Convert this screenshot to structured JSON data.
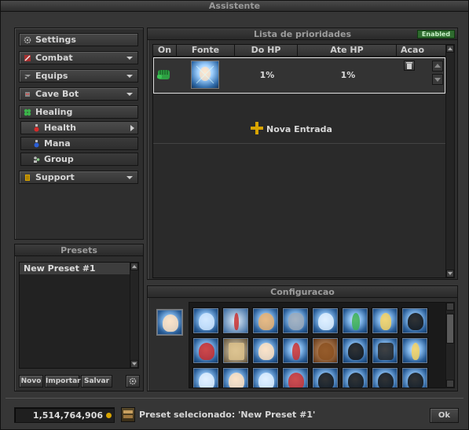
{
  "window": {
    "title": "Assistente"
  },
  "menu": {
    "settings": "Settings",
    "combat": "Combat",
    "equips": "Equips",
    "cavebot": "Cave Bot",
    "healing": "Healing",
    "health": "Health",
    "mana": "Mana",
    "group": "Group",
    "support": "Support"
  },
  "presets": {
    "title": "Presets",
    "items": [
      "New Preset #1"
    ],
    "novo": "Novo",
    "importar": "Importar",
    "salvar": "Salvar"
  },
  "priority": {
    "title": "Lista de prioridades",
    "badge": "Enabled",
    "columns": {
      "on": "On",
      "fonte": "Fonte",
      "do_hp": "Do HP",
      "ate_hp": "Ate HP",
      "acao": "Acao"
    },
    "row": {
      "do_hp": "1%",
      "ate_hp": "1%"
    },
    "add_label": "Nova Entrada"
  },
  "config": {
    "title": "Configuracao"
  },
  "footer": {
    "gold": "1,514,764,906",
    "status": "Preset selecionado: 'New Preset #1'",
    "ok": "Ok"
  },
  "colors": {
    "accent_green": "#2ea043",
    "gold": "#d8a400",
    "enabled_bg": "#2f6b2f"
  }
}
